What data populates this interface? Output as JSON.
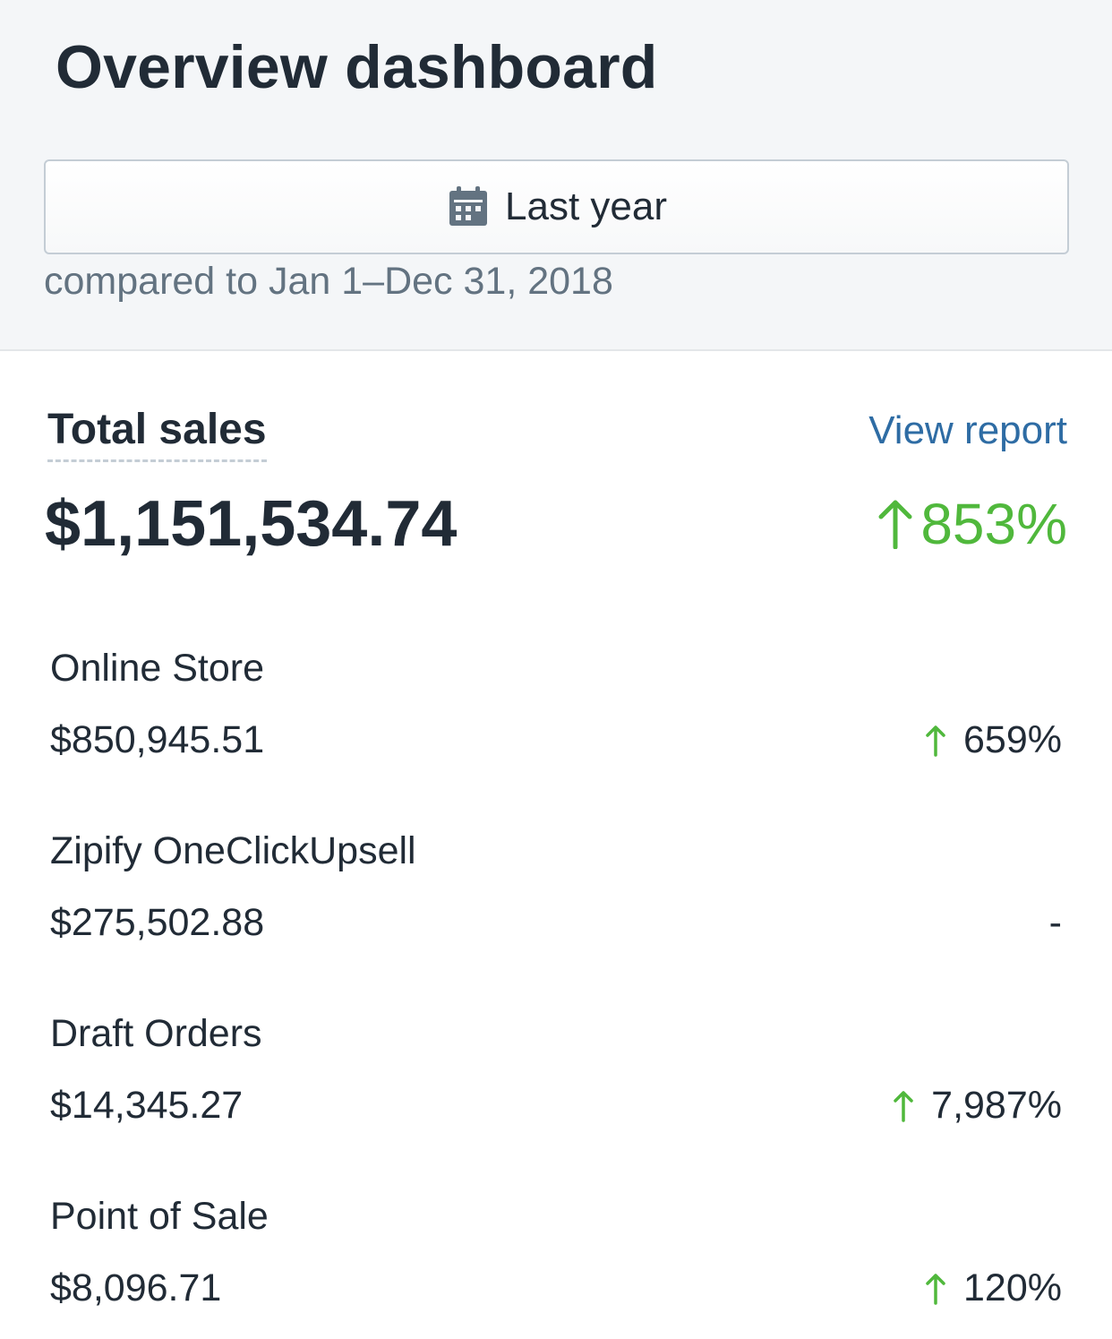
{
  "header": {
    "title": "Overview dashboard",
    "date_range": {
      "icon": "calendar-icon",
      "label": "Last year"
    },
    "comparison_text": "compared to Jan 1–Dec 31, 2018"
  },
  "total_sales": {
    "label": "Total sales",
    "view_report_label": "View report",
    "value": "$1,151,534.74",
    "change": "853%",
    "change_direction": "up"
  },
  "channels": [
    {
      "name": "Online Store",
      "amount": "$850,945.51",
      "change": "659%",
      "change_direction": "up"
    },
    {
      "name": "Zipify OneClickUpsell",
      "amount": "$275,502.88",
      "change": "-",
      "change_direction": "none"
    },
    {
      "name": "Draft Orders",
      "amount": "$14,345.27",
      "change": "7,987%",
      "change_direction": "up"
    },
    {
      "name": "Point of Sale",
      "amount": "$8,096.71",
      "change": "120%",
      "change_direction": "up"
    }
  ],
  "colors": {
    "positive": "#50b83c",
    "link": "#2e6ca4",
    "text": "#212b36",
    "subdued": "#637381"
  }
}
